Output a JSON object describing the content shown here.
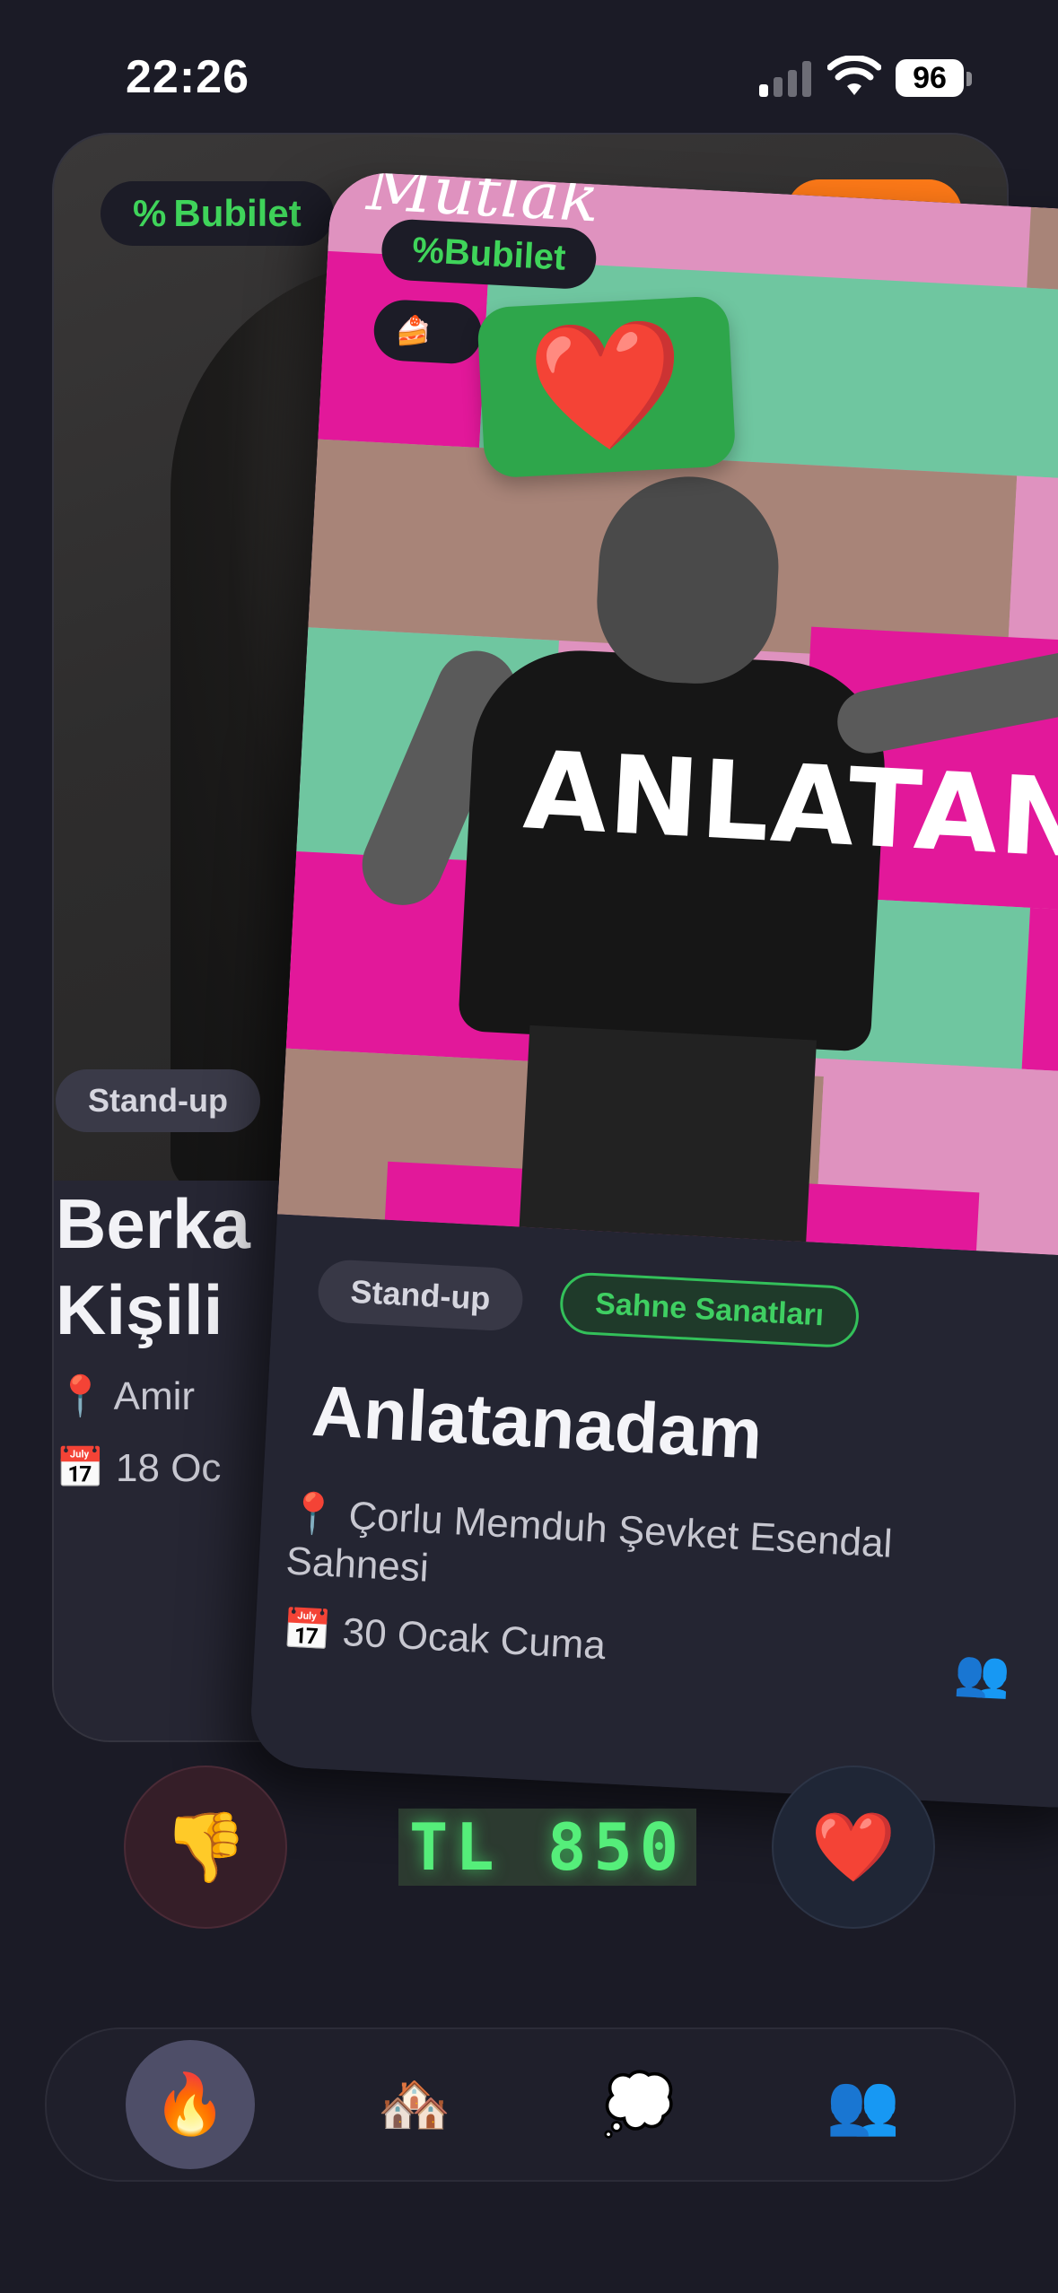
{
  "status_bar": {
    "time": "22:26",
    "battery": "96"
  },
  "back_card": {
    "brand": "Bubilet",
    "tag": "Stand-up",
    "title_line1": "Berka",
    "title_line2": "Kişili",
    "venue_icon": "📍",
    "venue": "Amir",
    "date_icon": "📅",
    "date": "18 Oc"
  },
  "front_card": {
    "brand": "Bubilet",
    "chip2_icon": "🍰",
    "like_stamp": "❤️",
    "poster_word": "ANLATANAD",
    "poster_scribble": "Mutlak",
    "tags": [
      "Stand-up",
      "Sahne Sanatları"
    ],
    "title": "Anlatanadam",
    "venue_icon": "📍",
    "venue": "Çorlu Memduh Şevket Esendal Sahnesi",
    "date_icon": "📅",
    "date": "30 Ocak Cuma",
    "people_icon": "👥"
  },
  "actions": {
    "dislike": "👎",
    "price": "TL 850",
    "like": "❤️"
  },
  "nav": {
    "items": [
      {
        "icon": "🔥",
        "name": "fire-icon",
        "active": true
      },
      {
        "icon": "🏘️",
        "name": "houses-icon",
        "active": false
      },
      {
        "icon": "💭",
        "name": "thought-bubble-icon",
        "active": false
      },
      {
        "icon": "👥",
        "name": "people-icon",
        "active": false
      }
    ]
  },
  "colors": {
    "background": "#1b1b26",
    "brand_green": "#3fd45a",
    "price_green": "#55ee7a",
    "poster_pink": "#df92bf",
    "poster_magenta": "#e2189a",
    "poster_mint": "#6fc6a0",
    "poster_tan": "#a88478",
    "stamp_green": "#2ea64b"
  }
}
